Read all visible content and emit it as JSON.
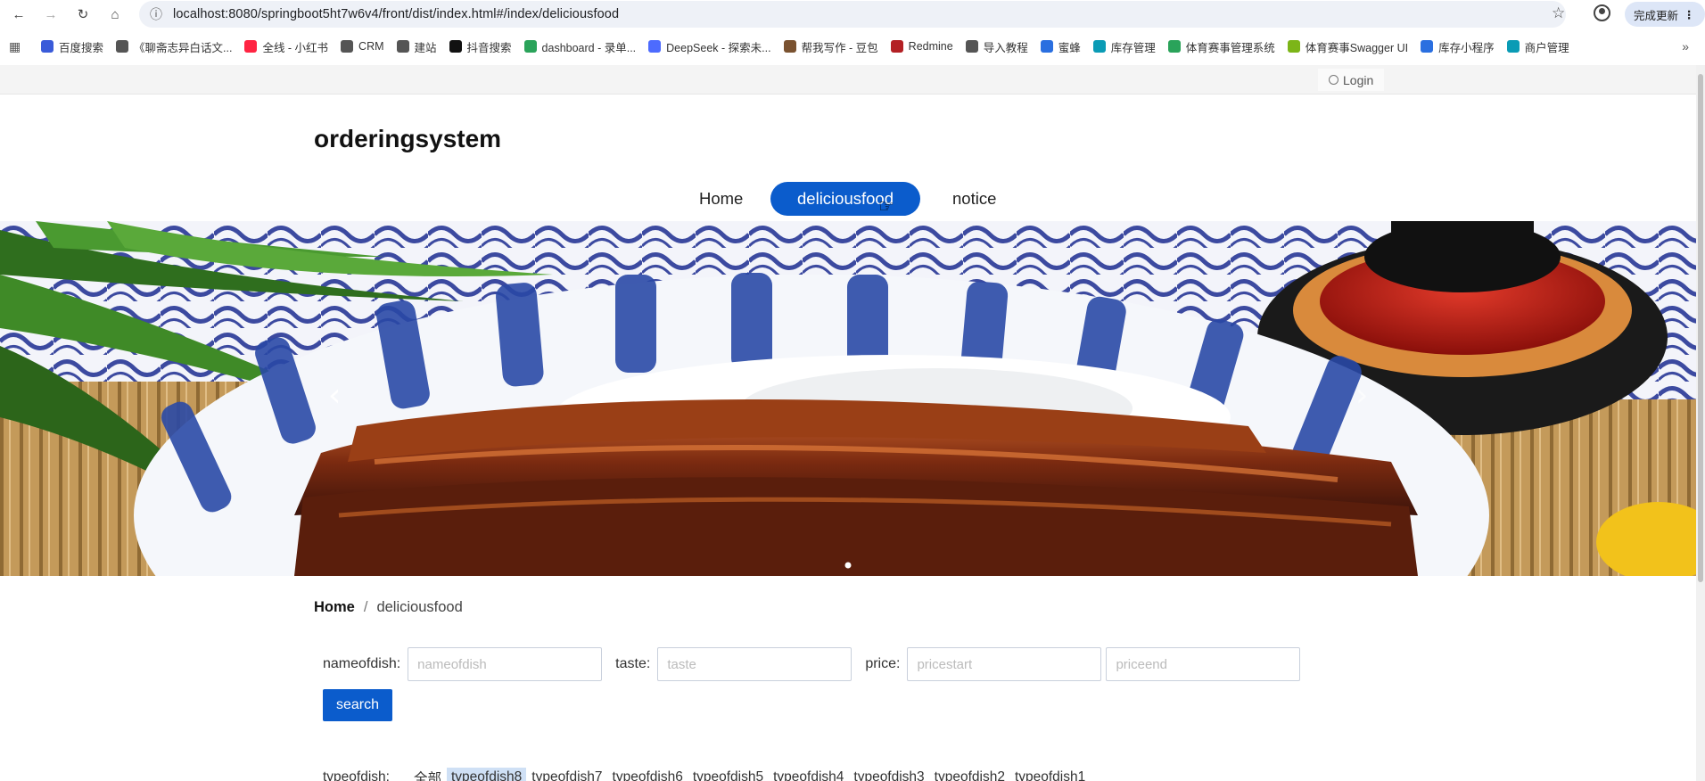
{
  "browser": {
    "url": "localhost:8080/springboot5ht7w6v4/front/dist/index.html#/index/deliciousfood",
    "update_label": "完成更新",
    "bookmarks": [
      {
        "label": "百度搜索",
        "color": "#3a5bd9"
      },
      {
        "label": "《聊斋志异白话文...",
        "color": "#555555"
      },
      {
        "label": "全线 - 小红书",
        "color": "#ff2442"
      },
      {
        "label": "CRM",
        "color": "#555555"
      },
      {
        "label": "建站",
        "color": "#555555"
      },
      {
        "label": "抖音搜索",
        "color": "#111111"
      },
      {
        "label": "dashboard - 录单...",
        "color": "#2aa35a"
      },
      {
        "label": "DeepSeek - 探索未...",
        "color": "#4d6bfe"
      },
      {
        "label": "帮我写作 - 豆包",
        "color": "#7a5230"
      },
      {
        "label": "Redmine",
        "color": "#b32024"
      },
      {
        "label": "导入教程",
        "color": "#555555"
      },
      {
        "label": "蜜蜂",
        "color": "#2a6fe0"
      },
      {
        "label": "库存管理",
        "color": "#0a9bb5"
      },
      {
        "label": "体育赛事管理系统",
        "color": "#2aa35a"
      },
      {
        "label": "体育赛事Swagger UI",
        "color": "#7cb518"
      },
      {
        "label": "库存小程序",
        "color": "#2a6fe0"
      },
      {
        "label": "商户管理",
        "color": "#0a9bb5"
      }
    ]
  },
  "header": {
    "login_label": "Login",
    "site_title": "orderingsystem"
  },
  "nav": {
    "items": [
      {
        "label": "Home"
      },
      {
        "label": "deliciousfood"
      },
      {
        "label": "notice"
      }
    ],
    "active_index": 1
  },
  "breadcrumb": {
    "home": "Home",
    "separator": "/",
    "current": "deliciousfood"
  },
  "filters": {
    "name_label": "nameofdish:",
    "name_placeholder": "nameofdish",
    "taste_label": "taste:",
    "taste_placeholder": "taste",
    "price_label": "price:",
    "price_start_placeholder": "pricestart",
    "price_end_placeholder": "priceend",
    "search_label": "search"
  },
  "types": {
    "label": "typeofdish:",
    "options": [
      "全部",
      "typeofdish8",
      "typeofdish7",
      "typeofdish6",
      "typeofdish5",
      "typeofdish4",
      "typeofdish3",
      "typeofdish2",
      "typeofdish1"
    ],
    "active_index": 1
  },
  "colors": {
    "accent": "#0b5ccc",
    "active_type_bg": "#cfe0f5"
  }
}
